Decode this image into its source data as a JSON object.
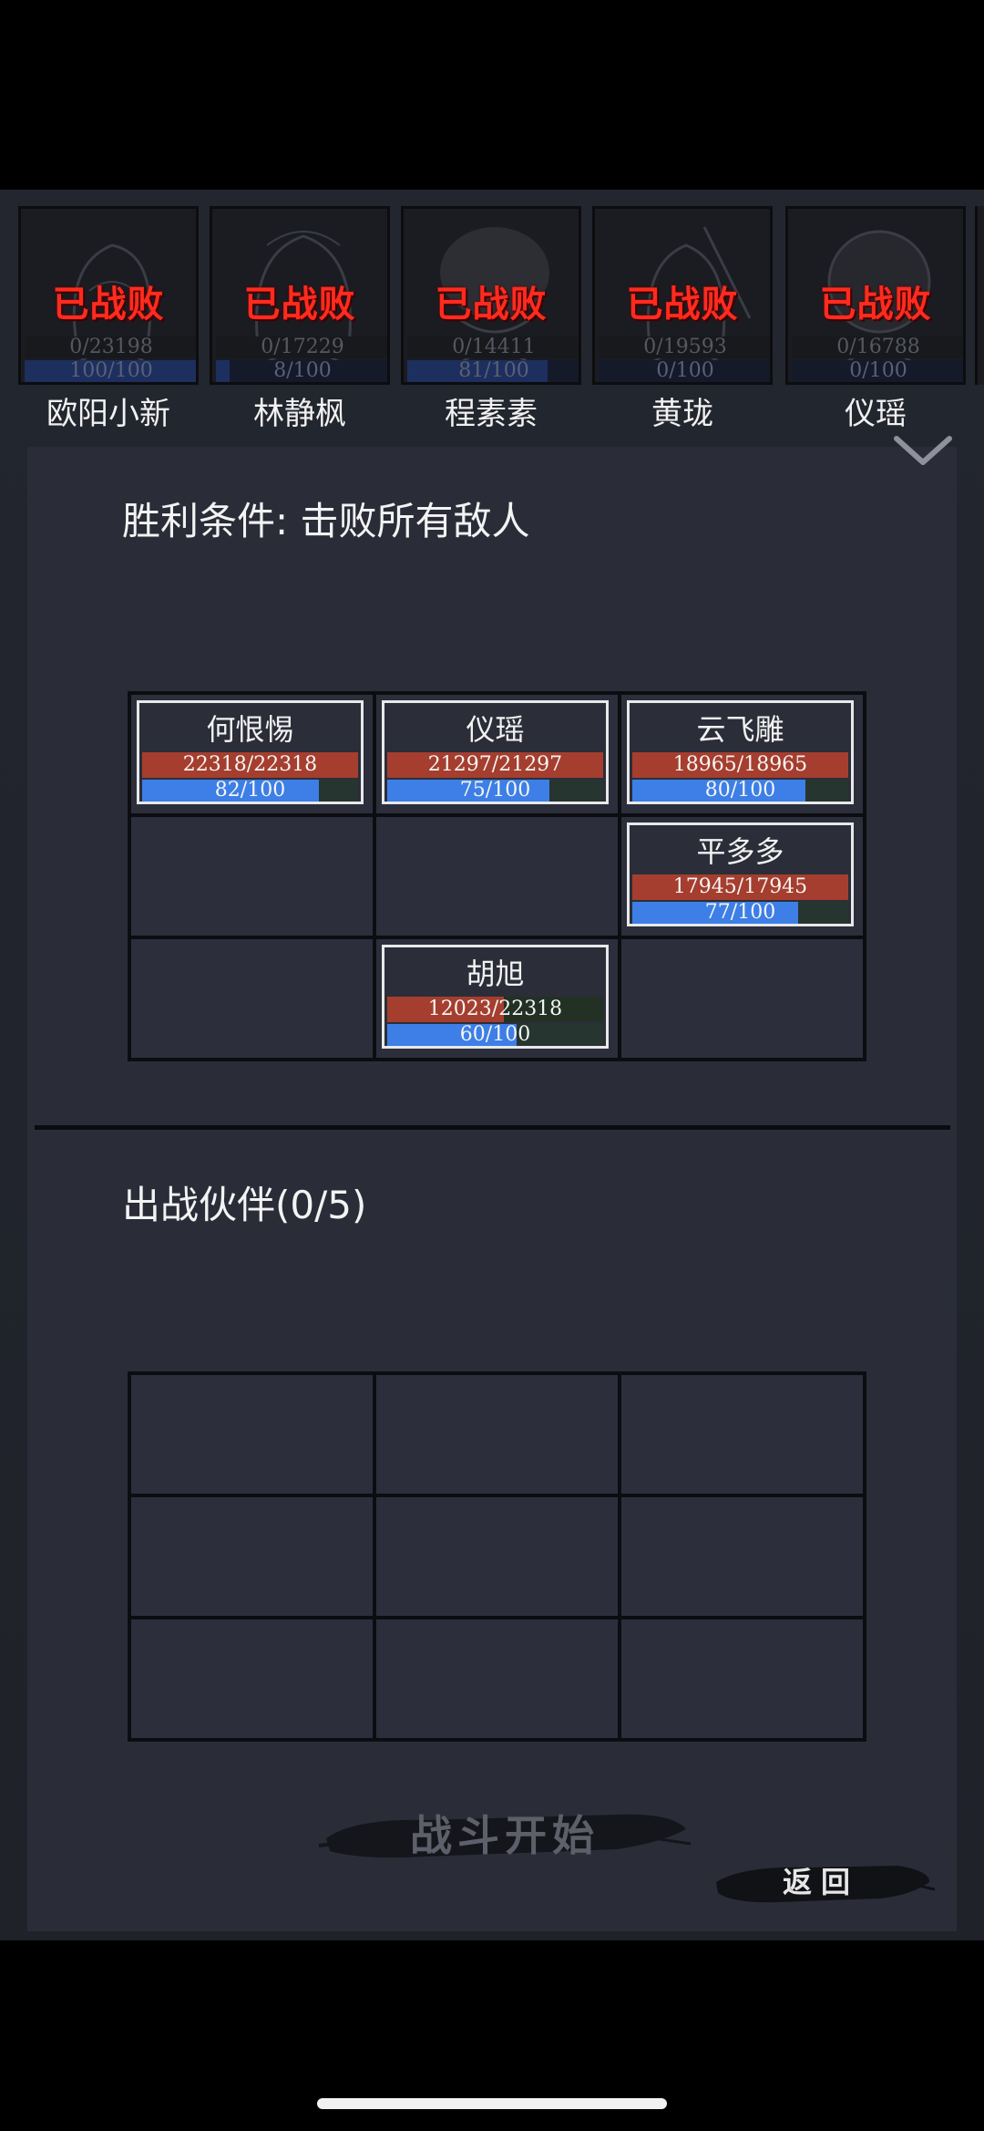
{
  "enemies": [
    {
      "name": "欧阳小新",
      "status": "已战败",
      "hp": "0/23198",
      "mp": "100/100",
      "mp_fraction": 1.0
    },
    {
      "name": "林静枫",
      "status": "已战败",
      "hp": "0/17229",
      "mp": "8/100",
      "mp_fraction": 0.08
    },
    {
      "name": "程素素",
      "status": "已战败",
      "hp": "0/14411",
      "mp": "81/100",
      "mp_fraction": 0.81
    },
    {
      "name": "黄珑",
      "status": "已战败",
      "hp": "0/19593",
      "mp": "0/100",
      "mp_fraction": 0.0
    },
    {
      "name": "仪瑶",
      "status": "已战败",
      "hp": "0/16788",
      "mp": "0/100",
      "mp_fraction": 0.0
    }
  ],
  "victory": {
    "title": "胜利条件: 击败所有敌人"
  },
  "enemy_grid": [
    {
      "name": "何恨惕",
      "hp": "22318/22318",
      "hp_fraction": 1.0,
      "mp": "82/100",
      "mp_fraction": 0.82
    },
    {
      "name": "仪瑶",
      "hp": "21297/21297",
      "hp_fraction": 1.0,
      "mp": "75/100",
      "mp_fraction": 0.75
    },
    {
      "name": "云飞雕",
      "hp": "18965/18965",
      "hp_fraction": 1.0,
      "mp": "80/100",
      "mp_fraction": 0.8
    },
    null,
    null,
    {
      "name": "平多多",
      "hp": "17945/17945",
      "hp_fraction": 1.0,
      "mp": "77/100",
      "mp_fraction": 0.77
    },
    null,
    {
      "name": "胡旭",
      "hp": "12023/22318",
      "hp_fraction": 0.54,
      "mp": "60/100",
      "mp_fraction": 0.6
    },
    null
  ],
  "partners": {
    "title": "出战伙伴(0/5)"
  },
  "buttons": {
    "start": "战斗开始",
    "back": "返回"
  },
  "icons": {
    "collapse": "chevron-down-icon"
  },
  "colors": {
    "defeat": "#ff2b1e",
    "hp": "#a53e2e",
    "mp": "#3d7fe6",
    "panel": "#2a2d38"
  }
}
